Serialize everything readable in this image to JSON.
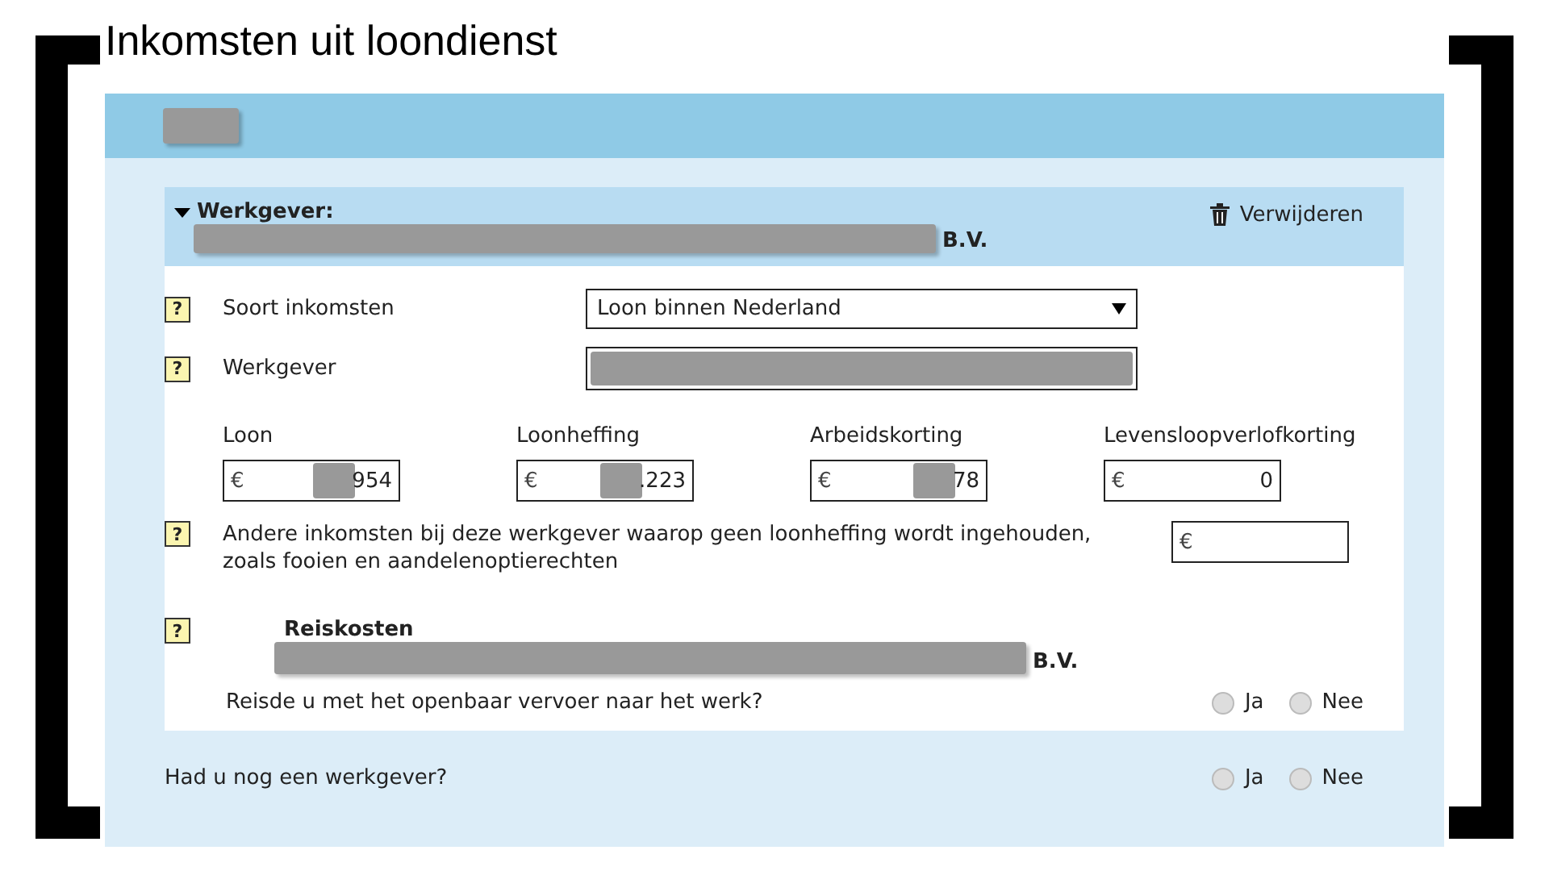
{
  "title": "Inkomsten uit loondienst",
  "employer": {
    "expanded": true,
    "label": "Werkgever:",
    "name_suffix": "B.V.",
    "delete": "Verwijderen"
  },
  "fields": [
    {
      "kind": "select",
      "help": "?",
      "label": "Soort inkomsten",
      "value": "Loon binnen Nederland"
    },
    {
      "kind": "redacted",
      "help": "?",
      "label": "Werkgever"
    }
  ],
  "amounts": [
    {
      "label": "Loon",
      "currency": "€",
      "value": "954",
      "redacted": true
    },
    {
      "label": "Loonheffing",
      "currency": "€",
      "value": ".223",
      "redacted": true
    },
    {
      "label": "Arbeidskorting",
      "currency": "€",
      "value": "78",
      "redacted": true
    },
    {
      "label": "Levensloopverlofkorting",
      "currency": "€",
      "value": "0",
      "redacted": false
    }
  ],
  "other_income": {
    "help": "?",
    "label": "Andere inkomsten bij deze werkgever waarop geen loonheffing wordt ingehouden, zoals fooien en aandelenoptierechten",
    "currency": "€"
  },
  "travel": {
    "help": "?",
    "title": "Reiskosten",
    "name_suffix": "B.V.",
    "question": "Reisde u met het openbaar vervoer naar het werk?",
    "options": [
      {
        "label": "Ja",
        "selected": false
      },
      {
        "label": "Nee",
        "selected": false
      }
    ]
  },
  "another_employer": {
    "question": "Had u nog een werkgever?",
    "options": [
      {
        "label": "Ja",
        "selected": false
      },
      {
        "label": "Nee",
        "selected": false
      }
    ]
  }
}
